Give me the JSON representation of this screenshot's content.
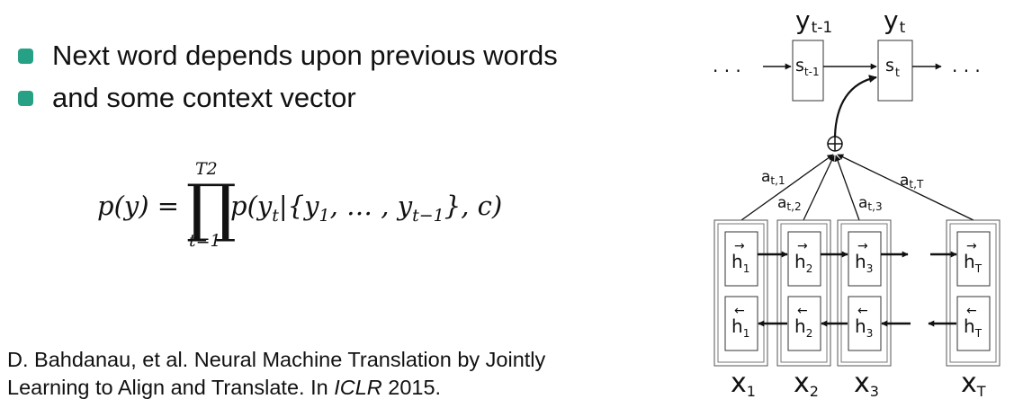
{
  "bullets": [
    {
      "text": "Next word depends upon previous words"
    },
    {
      "text": "and some context vector"
    }
  ],
  "formula": {
    "lhs": "p(y) =",
    "product_symbol": "∏",
    "upper_limit": "T2",
    "lower_limit": "t=1",
    "rhs_p": "p(y",
    "rhs_t": "t",
    "rhs_mid": "|{y",
    "rhs_one": "1",
    "rhs_dots": ", … , y",
    "rhs_tm1": "t−1",
    "rhs_end": "}, c)"
  },
  "citation": {
    "line1": "D. Bahdanau, et al. Neural Machine Translation by Jointly",
    "line2_before": "Learning to Align and Translate. In ",
    "line2_venue": "ICLR",
    "line2_after": " 2015."
  },
  "diagram": {
    "ellipsis": ". . .",
    "decoder": [
      {
        "out_base": "y",
        "out_sub": "t-1",
        "state_base": "s",
        "state_sub": "t-1"
      },
      {
        "out_base": "y",
        "out_sub": "t",
        "state_base": "s",
        "state_sub": "t"
      }
    ],
    "combiner_symbol": "⊕",
    "attention_weights": [
      {
        "base": "a",
        "sub": "t,1"
      },
      {
        "base": "a",
        "sub": "t,2"
      },
      {
        "base": "a",
        "sub": "t,3"
      },
      {
        "base": "a",
        "sub": "t,T"
      }
    ],
    "forward_arrow": "→",
    "backward_arrow": "←",
    "encoder": [
      {
        "h_base": "h",
        "h_sub": "1",
        "x_base": "x",
        "x_sub": "1"
      },
      {
        "h_base": "h",
        "h_sub": "2",
        "x_base": "x",
        "x_sub": "2"
      },
      {
        "h_base": "h",
        "h_sub": "3",
        "x_base": "x",
        "x_sub": "3"
      },
      {
        "h_base": "h",
        "h_sub": "T",
        "x_base": "x",
        "x_sub": "T"
      }
    ]
  }
}
